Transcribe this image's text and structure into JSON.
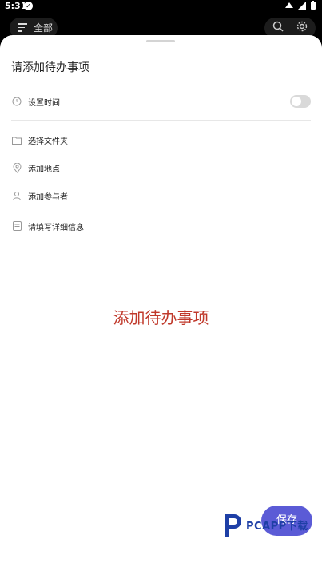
{
  "status_bar": {
    "time": "5:31"
  },
  "top_bar": {
    "menu_label": "全部"
  },
  "sheet": {
    "title": "请添加待办事项",
    "set_time_label": "设置时间",
    "select_folder_label": "选择文件夹",
    "add_location_label": "添加地点",
    "add_participant_label": "添加参与者",
    "details_label": "请填写详细信息",
    "caption": "添加待办事项",
    "save_label": "保存"
  },
  "watermark": {
    "text": "PCAPP下载"
  },
  "colors": {
    "accent": "#5b5bd6",
    "caption": "#c0392b"
  },
  "icons": [
    "menu-icon",
    "search-icon",
    "gear-icon",
    "clock-icon",
    "folder-icon",
    "location-icon",
    "person-icon",
    "note-icon"
  ]
}
